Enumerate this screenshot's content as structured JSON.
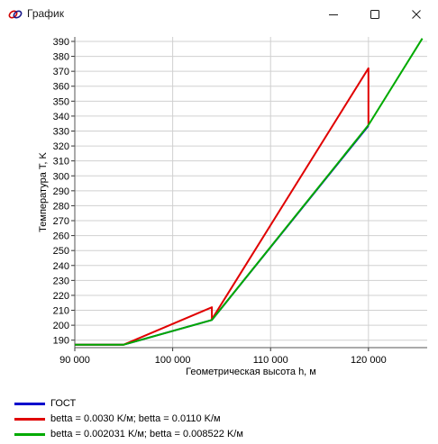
{
  "window": {
    "title": "График",
    "icon": "chart-app-icon",
    "controls": [
      "minimize-icon",
      "maximize-icon",
      "close-icon"
    ]
  },
  "chart_data": {
    "type": "line",
    "xlabel": "Геометрическая высота h, м",
    "ylabel": "Температура T, K",
    "xlim": [
      90000,
      126000
    ],
    "ylim": [
      185,
      393
    ],
    "x_ticks": [
      {
        "v": 90000,
        "label": "90 000"
      },
      {
        "v": 100000,
        "label": "100 000"
      },
      {
        "v": 110000,
        "label": "110 000"
      },
      {
        "v": 120000,
        "label": "120 000"
      }
    ],
    "y_ticks": [
      {
        "v": 190,
        "label": "190"
      },
      {
        "v": 200,
        "label": "200"
      },
      {
        "v": 210,
        "label": "210"
      },
      {
        "v": 220,
        "label": "220"
      },
      {
        "v": 230,
        "label": "230"
      },
      {
        "v": 240,
        "label": "240"
      },
      {
        "v": 250,
        "label": "250"
      },
      {
        "v": 260,
        "label": "260"
      },
      {
        "v": 270,
        "label": "270"
      },
      {
        "v": 280,
        "label": "280"
      },
      {
        "v": 290,
        "label": "290"
      },
      {
        "v": 300,
        "label": "300"
      },
      {
        "v": 310,
        "label": "310"
      },
      {
        "v": 320,
        "label": "320"
      },
      {
        "v": 330,
        "label": "330"
      },
      {
        "v": 340,
        "label": "340"
      },
      {
        "v": 350,
        "label": "350"
      },
      {
        "v": 360,
        "label": "360"
      },
      {
        "v": 370,
        "label": "370"
      },
      {
        "v": 380,
        "label": "380"
      },
      {
        "v": 390,
        "label": "390"
      }
    ],
    "grid": true,
    "legend_position": "bottom-left",
    "series": [
      {
        "name": "ГОСТ",
        "color": "#0000cc",
        "x": [
          90000,
          95000,
          104000,
          120000
        ],
        "y": [
          186.9,
          187,
          203.5,
          333.5
        ]
      },
      {
        "name": "betta = 0.0030 K/м; betta = 0.0110 K/м",
        "color": "#e00000",
        "x": [
          90000,
          95000,
          104000,
          104000,
          120000,
          120000
        ],
        "y": [
          186.9,
          187,
          212,
          204,
          372,
          334
        ]
      },
      {
        "name": "betta = 0.002031 K/м; betta = 0.008522 K/м",
        "color": "#00aa00",
        "x": [
          90000,
          95000,
          104000,
          120000,
          125500
        ],
        "y": [
          186.9,
          187,
          203.5,
          334,
          392
        ]
      }
    ]
  }
}
